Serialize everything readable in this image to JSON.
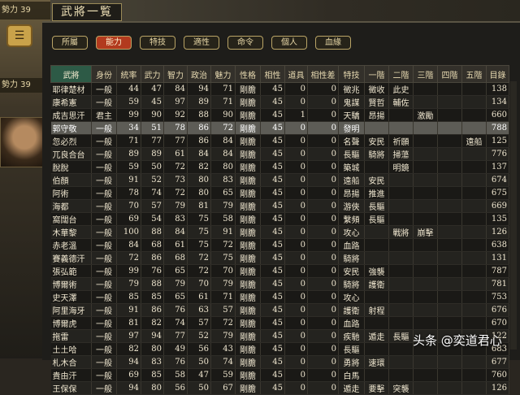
{
  "window": {
    "title": "武將一覧",
    "left_top_text": "勢力 39",
    "left_mid_text": "勢力 39"
  },
  "tabs": [
    "所屬",
    "能力",
    "特技",
    "適性",
    "命令",
    "個人",
    "血緣"
  ],
  "active_tab": 1,
  "columns": [
    "武將",
    "身份",
    "統率",
    "武力",
    "智力",
    "政治",
    "魅力",
    "性格",
    "相性",
    "道具",
    "相性差",
    "特技",
    "一階",
    "二階",
    "三階",
    "四階",
    "五階",
    "目錄"
  ],
  "sorted_column": 0,
  "highlight_row": 3,
  "rows": [
    [
      "耶律楚材",
      "一般",
      "44",
      "47",
      "84",
      "94",
      "71",
      "剛膽",
      "45",
      "0",
      "0",
      "徵兆",
      "徵收",
      "此史",
      "",
      "",
      "",
      "138"
    ],
    [
      "康希憲",
      "一般",
      "59",
      "45",
      "97",
      "89",
      "71",
      "剛膽",
      "45",
      "0",
      "0",
      "鬼謀",
      "賢哲",
      "輔佐",
      "",
      "",
      "",
      "134"
    ],
    [
      "成吉思汗",
      "君主",
      "99",
      "90",
      "92",
      "88",
      "90",
      "剛膽",
      "45",
      "1",
      "0",
      "天驕",
      "昂揚",
      "",
      "激勵",
      "",
      "",
      "660"
    ],
    [
      "郭守敬",
      "一般",
      "34",
      "51",
      "78",
      "86",
      "72",
      "剛膽",
      "45",
      "0",
      "0",
      "發明",
      "",
      "",
      "",
      "",
      "",
      "788"
    ],
    [
      "忽必烈",
      "一般",
      "71",
      "77",
      "77",
      "86",
      "84",
      "剛膽",
      "45",
      "0",
      "0",
      "名聲",
      "安民",
      "祈願",
      "",
      "",
      "遠船",
      "125"
    ],
    [
      "兀良合台",
      "一般",
      "89",
      "89",
      "61",
      "84",
      "84",
      "剛膽",
      "45",
      "0",
      "0",
      "長驅",
      "騎將",
      "掃蕩",
      "",
      "",
      "",
      "776"
    ],
    [
      "脫脫",
      "一般",
      "59",
      "50",
      "72",
      "82",
      "80",
      "剛膽",
      "45",
      "0",
      "0",
      "築城",
      "",
      "明鏡",
      "",
      "",
      "",
      "137"
    ],
    [
      "伯顏",
      "一般",
      "91",
      "52",
      "73",
      "80",
      "83",
      "剛膽",
      "45",
      "0",
      "0",
      "遠船",
      "安民",
      "",
      "",
      "",
      "",
      "674"
    ],
    [
      "阿術",
      "一般",
      "78",
      "74",
      "72",
      "80",
      "65",
      "剛膽",
      "45",
      "0",
      "0",
      "昂揚",
      "推進",
      "",
      "",
      "",
      "",
      "675"
    ],
    [
      "海都",
      "一般",
      "70",
      "57",
      "79",
      "81",
      "79",
      "剛膽",
      "45",
      "0",
      "0",
      "游俠",
      "長驅",
      "",
      "",
      "",
      "",
      "669"
    ],
    [
      "窩闊台",
      "一般",
      "69",
      "54",
      "83",
      "75",
      "58",
      "剛膽",
      "45",
      "0",
      "0",
      "繫頻",
      "長驅",
      "",
      "",
      "",
      "",
      "135"
    ],
    [
      "木華黎",
      "一般",
      "100",
      "88",
      "84",
      "75",
      "91",
      "剛膽",
      "45",
      "0",
      "0",
      "攻心",
      "",
      "戰將",
      "崩擊",
      "",
      "",
      "126"
    ],
    [
      "赤老溫",
      "一般",
      "84",
      "68",
      "61",
      "75",
      "72",
      "剛膽",
      "45",
      "0",
      "0",
      "血路",
      "",
      "",
      "",
      "",
      "",
      "638"
    ],
    [
      "賽義德汗",
      "一般",
      "72",
      "86",
      "68",
      "72",
      "75",
      "剛膽",
      "45",
      "0",
      "0",
      "騎將",
      "",
      "",
      "",
      "",
      "",
      "131"
    ],
    [
      "張弘範",
      "一般",
      "99",
      "76",
      "65",
      "72",
      "70",
      "剛膽",
      "45",
      "0",
      "0",
      "安民",
      "強襲",
      "",
      "",
      "",
      "",
      "787"
    ],
    [
      "博爾術",
      "一般",
      "79",
      "88",
      "79",
      "70",
      "79",
      "剛膽",
      "45",
      "0",
      "0",
      "騎將",
      "護衛",
      "",
      "",
      "",
      "",
      "781"
    ],
    [
      "史天澤",
      "一般",
      "85",
      "85",
      "65",
      "61",
      "71",
      "剛膽",
      "45",
      "0",
      "0",
      "攻心",
      "",
      "",
      "",
      "",
      "",
      "753"
    ],
    [
      "阿里海牙",
      "一般",
      "91",
      "86",
      "76",
      "63",
      "57",
      "剛膽",
      "45",
      "0",
      "0",
      "護衛",
      "射程",
      "",
      "",
      "",
      "",
      "676"
    ],
    [
      "博爾虎",
      "一般",
      "81",
      "82",
      "74",
      "57",
      "72",
      "剛膽",
      "45",
      "0",
      "0",
      "血路",
      "",
      "",
      "",
      "",
      "",
      "670"
    ],
    [
      "拖雷",
      "一般",
      "97",
      "94",
      "77",
      "52",
      "79",
      "剛膽",
      "45",
      "0",
      "0",
      "疾馳",
      "遁走",
      "長驅",
      "",
      "",
      "",
      "122"
    ],
    [
      "土土哈",
      "一般",
      "82",
      "80",
      "49",
      "56",
      "43",
      "剛膽",
      "45",
      "0",
      "0",
      "長驅",
      "",
      "",
      "",
      "",
      "",
      "683"
    ],
    [
      "札木合",
      "一般",
      "94",
      "83",
      "76",
      "50",
      "74",
      "剛膽",
      "45",
      "0",
      "0",
      "勇將",
      "速環",
      "",
      "",
      "",
      "",
      "677"
    ],
    [
      "貴由汗",
      "一般",
      "69",
      "85",
      "58",
      "47",
      "59",
      "剛膽",
      "45",
      "0",
      "0",
      "白馬",
      "",
      "",
      "",
      "",
      "",
      "760"
    ],
    [
      "王保保",
      "一般",
      "94",
      "80",
      "56",
      "50",
      "67",
      "剛膽",
      "45",
      "0",
      "0",
      "遁走",
      "要擊",
      "突襲",
      "",
      "",
      "",
      "126"
    ]
  ],
  "watermark": "头条 @奕道君心"
}
